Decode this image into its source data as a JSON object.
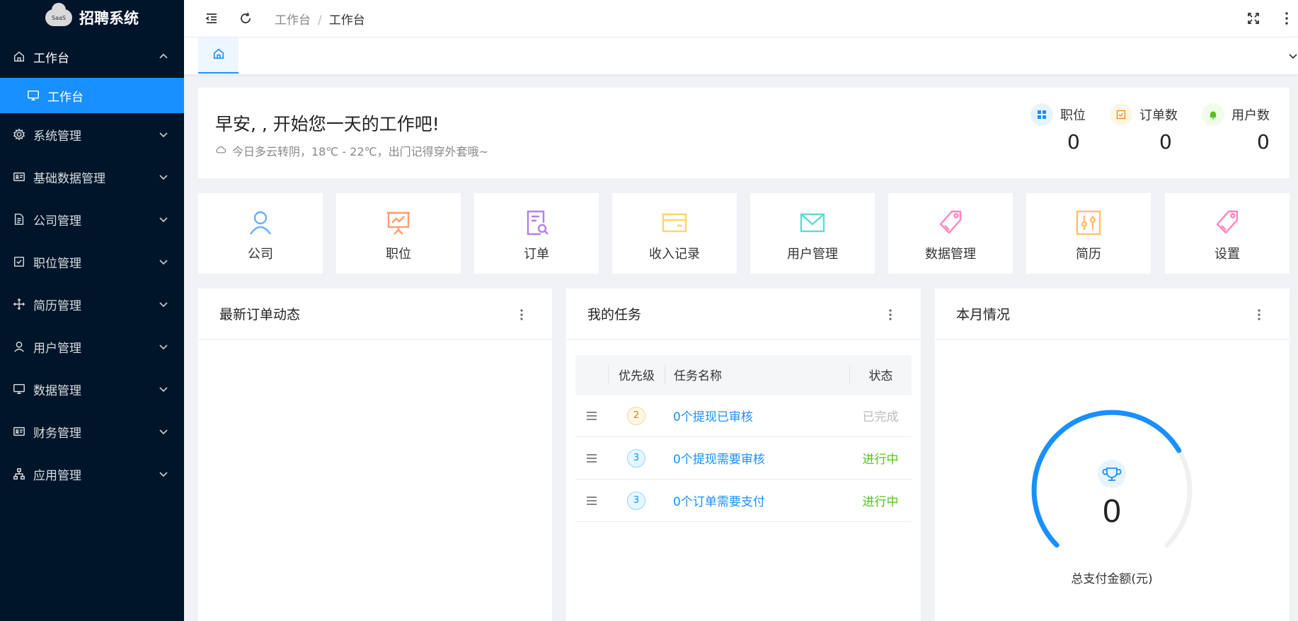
{
  "sidebar": {
    "logo_badge": "SaaS",
    "logo_text": "招聘系统",
    "menu": [
      {
        "label": "工作台"
      },
      {
        "label": "系统管理"
      },
      {
        "label": "基础数据管理"
      },
      {
        "label": "公司管理"
      },
      {
        "label": "职位管理"
      },
      {
        "label": "简历管理"
      },
      {
        "label": "用户管理"
      },
      {
        "label": "数据管理"
      },
      {
        "label": "财务管理"
      },
      {
        "label": "应用管理"
      }
    ],
    "active_sub": "工作台"
  },
  "header": {
    "breadcrumb": [
      "工作台",
      "工作台"
    ],
    "separator": "/"
  },
  "welcome": {
    "greeting": "早安, , 开始您一天的工作吧!",
    "weather": "今日多云转阴，18℃ - 22℃，出门记得穿外套哦~",
    "stats": [
      {
        "label": "职位",
        "value": "0",
        "color": "#1890ff"
      },
      {
        "label": "订单数",
        "value": "0",
        "color": "#fa8c16"
      },
      {
        "label": "用户数",
        "value": "0",
        "color": "#52c41a"
      }
    ]
  },
  "shortcuts": [
    {
      "label": "公司",
      "icon": "user-icon",
      "color": "#69b1ff"
    },
    {
      "label": "职位",
      "icon": "presentation-icon",
      "color": "#ff9c6e"
    },
    {
      "label": "订单",
      "icon": "document-search-icon",
      "color": "#b37feb"
    },
    {
      "label": "收入记录",
      "icon": "card-icon",
      "color": "#ffd666"
    },
    {
      "label": "用户管理",
      "icon": "mail-icon",
      "color": "#5cdbd3"
    },
    {
      "label": "数据管理",
      "icon": "tag-icon",
      "color": "#ff85c0"
    },
    {
      "label": "简历",
      "icon": "sliders-icon",
      "color": "#ffc069"
    },
    {
      "label": "设置",
      "icon": "tag-icon",
      "color": "#ff85c0"
    }
  ],
  "panels": {
    "orders_title": "最新订单动态",
    "tasks_title": "我的任务",
    "month_title": "本月情况"
  },
  "tasks": {
    "headers": {
      "priority": "优先级",
      "name": "任务名称",
      "status": "状态"
    },
    "rows": [
      {
        "priority": "2",
        "name": "0个提现已审核",
        "status": "已完成"
      },
      {
        "priority": "3",
        "name": "0个提现需要审核",
        "status": "进行中"
      },
      {
        "priority": "3",
        "name": "0个订单需要支付",
        "status": "进行中"
      }
    ]
  },
  "month": {
    "value": "0",
    "label": "总支付金额(元)",
    "gauge_fraction": 0.72,
    "gauge_color": "#1890ff"
  }
}
